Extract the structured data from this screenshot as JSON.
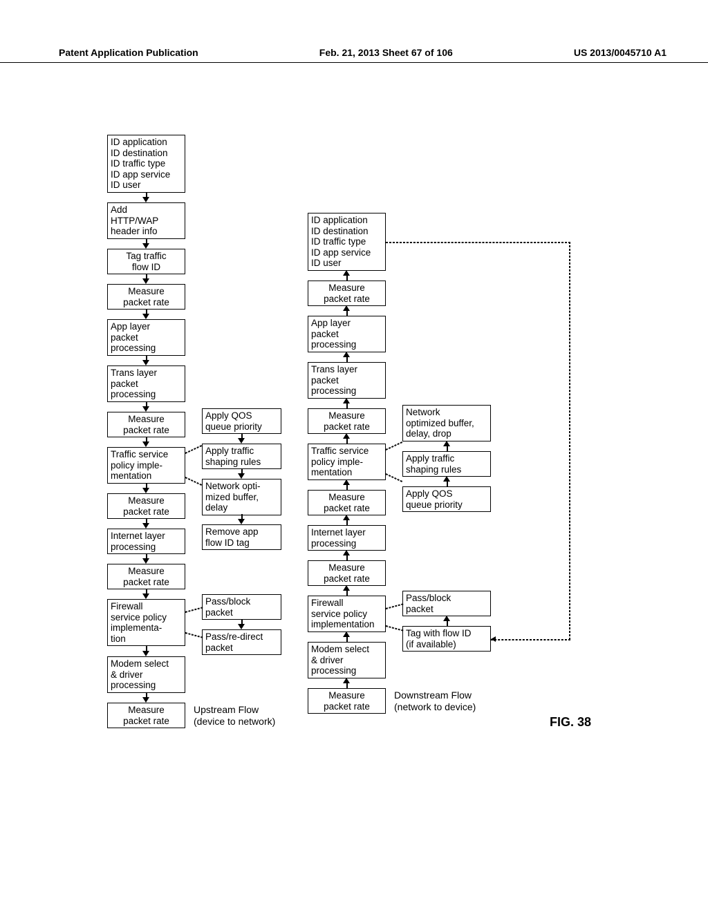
{
  "header": {
    "left": "Patent Application Publication",
    "center": "Feb. 21, 2013  Sheet 67 of 106",
    "right": "US 2013/0045710 A1"
  },
  "figure_label": "FIG. 38",
  "upstream_label": "Upstream Flow\n(device to network)",
  "downstream_label": "Downstream Flow\n(network to device)",
  "left_col": {
    "b0": "ID application\nID destination\nID traffic type\nID app service\nID user",
    "b1": "Add\nHTTP/WAP\nheader info",
    "b2": "Tag traffic\nflow ID",
    "b3": "Measure\npacket rate",
    "b4": "App layer\npacket\nprocessing",
    "b5": "Trans layer\npacket\nprocessing",
    "b6": "Measure\npacket rate",
    "b7": "Traffic service\npolicy imple-\nmentation",
    "b8": "Measure\npacket rate",
    "b9": "Internet layer\nprocessing",
    "b10": "Measure\npacket rate",
    "b11": "Firewall\nservice policy\nimplementa-\ntion",
    "b12": "Modem select\n& driver\nprocessing",
    "b13": "Measure\npacket rate"
  },
  "left_side": {
    "s0": "Apply QOS\nqueue priority",
    "s1": "Apply traffic\nshaping rules",
    "s2": "Network opti-\nmized buffer,\ndelay",
    "s3": "Remove app\nflow ID tag",
    "s4": "Pass/block\npacket",
    "s5": "Pass/re-direct\npacket"
  },
  "right_col": {
    "b0": "ID application\nID destination\nID traffic type\nID app service\nID user",
    "b1": "Measure\npacket rate",
    "b2": "App layer\npacket\nprocessing",
    "b3": "Trans layer\npacket\nprocessing",
    "b4": "Measure\npacket rate",
    "b5": "Traffic service\npolicy imple-\nmentation",
    "b6": "Measure\npacket rate",
    "b7": "Internet layer\nprocessing",
    "b8": "Measure\npacket rate",
    "b9": "Firewall\nservice policy\nimplementation",
    "b10": "Modem select\n& driver\nprocessing",
    "b11": "Measure\npacket rate"
  },
  "right_side": {
    "s0": "Network\noptimized buffer,\ndelay, drop",
    "s1": "Apply traffic\nshaping rules",
    "s2": "Apply QOS\nqueue priority",
    "s3": "Pass/block\npacket",
    "s4": "Tag with flow ID\n(if available)"
  }
}
